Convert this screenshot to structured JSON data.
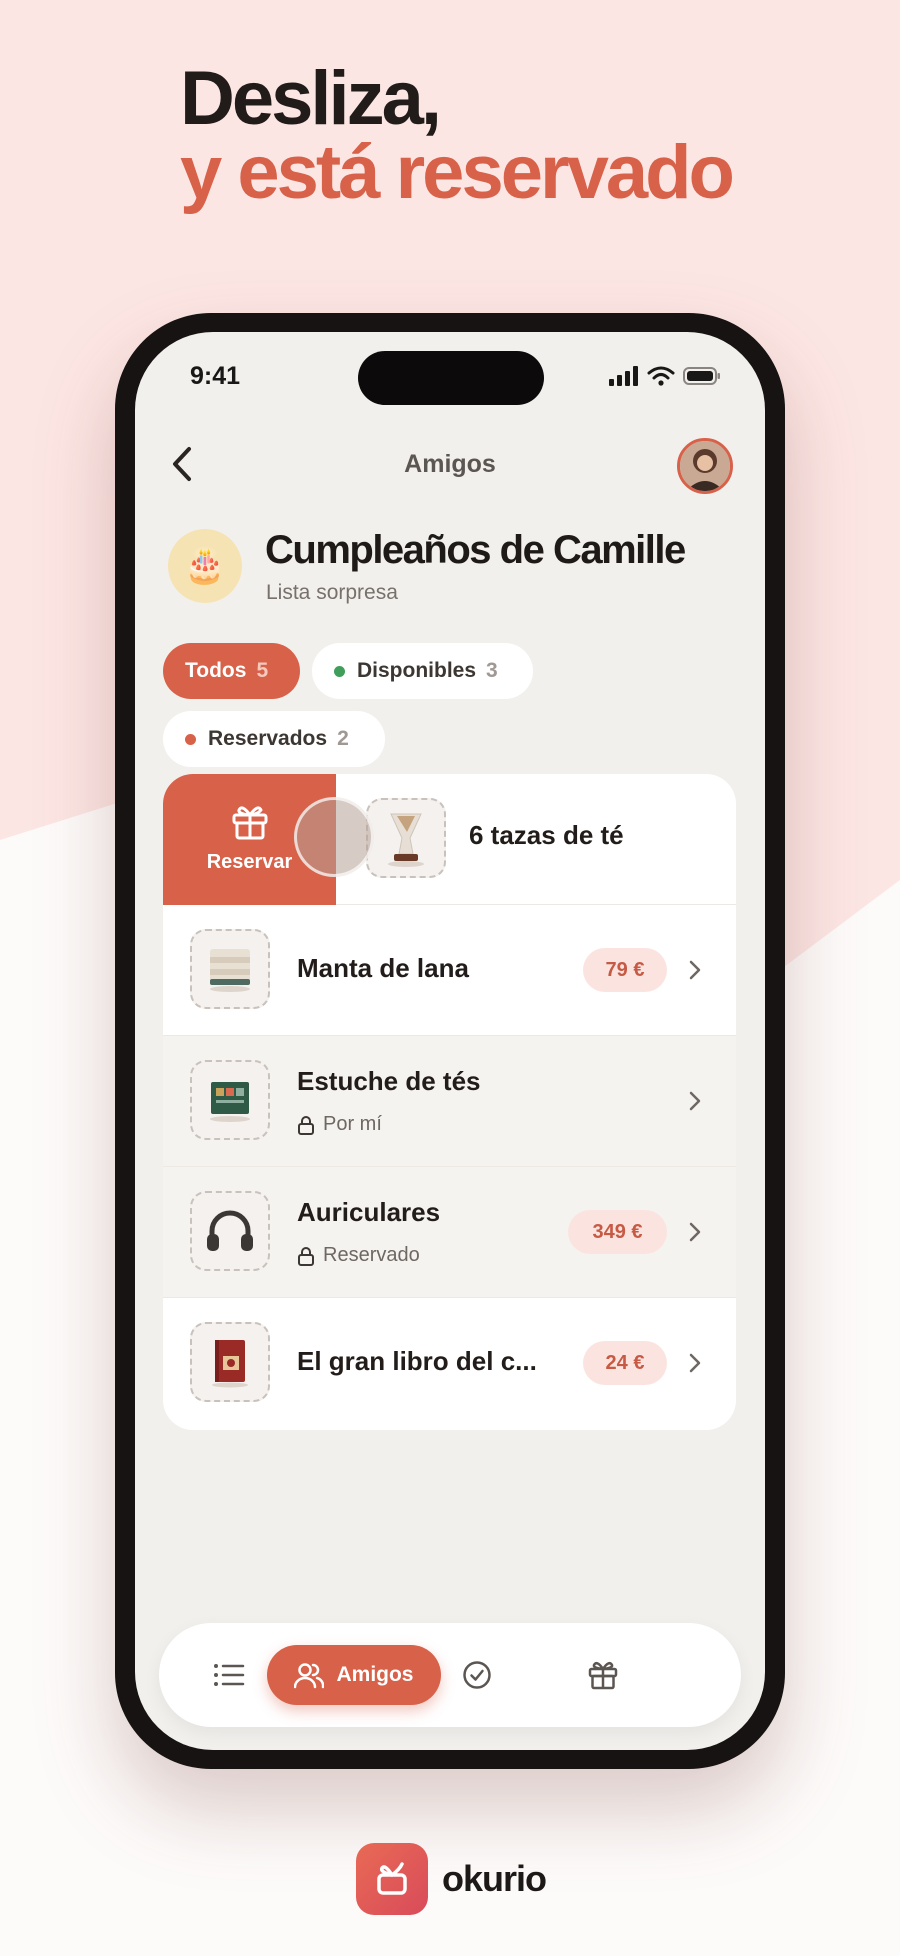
{
  "headline": {
    "line1": "Desliza,",
    "line2": "y está reservado"
  },
  "status_bar": {
    "time": "9:41"
  },
  "nav": {
    "title": "Amigos"
  },
  "event": {
    "emoji": "🎂",
    "title": "Cumpleaños de Camille",
    "subtitle": "Lista sorpresa"
  },
  "filters": [
    {
      "label": "Todos",
      "count": "5",
      "active": true
    },
    {
      "label": "Disponibles",
      "count": "3",
      "dot_color": "#3f9e5a"
    },
    {
      "label": "Reservados",
      "count": "2",
      "dot_color": "#d8614a"
    }
  ],
  "swipe_row": {
    "action_label": "Reservar",
    "name": "6 tazas de té"
  },
  "items": [
    {
      "name": "Manta de lana",
      "price": "79 €"
    },
    {
      "name": "Estuche de tés",
      "status": "Por mí"
    },
    {
      "name": "Auriculares",
      "status": "Reservado",
      "price": "349 €"
    },
    {
      "name": "El gran libro del c...",
      "price": "24 €"
    }
  ],
  "tabbar": {
    "active_label": "Amigos"
  },
  "brand": {
    "name": "okurio"
  },
  "colors": {
    "accent": "#d8614a",
    "background_pink": "#fce6e4",
    "screen_bg": "#f2f0ed",
    "available_green": "#3f9e5a"
  }
}
